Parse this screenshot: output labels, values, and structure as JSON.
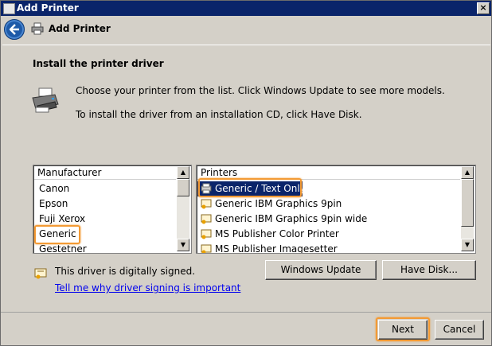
{
  "window": {
    "title": "Add Printer"
  },
  "header": {
    "title": "Add Printer"
  },
  "content": {
    "heading": "Install the printer driver",
    "line1": "Choose your printer from the list. Click Windows Update to see more models.",
    "line2": "To install the driver from an installation CD, click Have Disk."
  },
  "manufacturers": {
    "header": "Manufacturer",
    "items": [
      "Canon",
      "Epson",
      "Fuji Xerox",
      "Generic",
      "Gestetner"
    ],
    "selected": "Generic"
  },
  "printers": {
    "header": "Printers",
    "items": [
      "Generic / Text Only",
      "Generic IBM Graphics 9pin",
      "Generic IBM Graphics 9pin wide",
      "MS Publisher Color Printer",
      "MS Publisher Imagesetter"
    ],
    "selected": "Generic / Text Only"
  },
  "signing": {
    "status": "This driver is digitally signed.",
    "link": "Tell me why driver signing is important"
  },
  "buttons": {
    "windows_update": "Windows Update",
    "have_disk": "Have Disk...",
    "next": "Next",
    "cancel": "Cancel"
  },
  "colors": {
    "highlight": "#f39a34",
    "selection": "#0a246a",
    "titlebar": "#0a246a",
    "link": "#0000ee"
  }
}
